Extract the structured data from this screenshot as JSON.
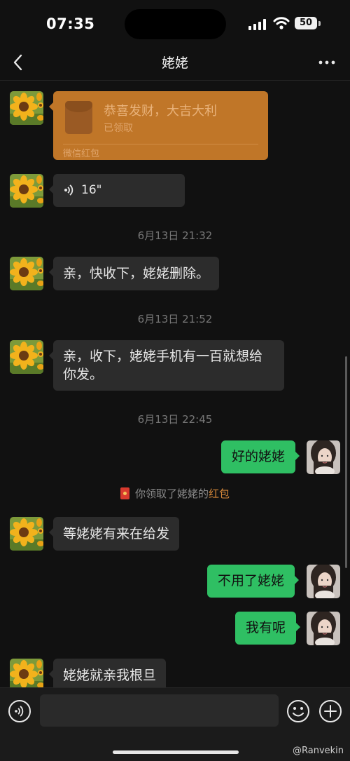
{
  "status_bar": {
    "time": "07:35",
    "battery": "50"
  },
  "header": {
    "title": "姥姥"
  },
  "messages": {
    "red_packet": {
      "title": "恭喜发财，大吉大利",
      "status": "已领取",
      "footer": "微信红包"
    },
    "voice": {
      "duration": "16\""
    },
    "ts1": "6月13日 21:32",
    "m1": "亲，快收下，姥姥删除。",
    "ts2": "6月13日 21:52",
    "m2_line1": "亲，收下，姥姥手机有一百就想给",
    "m2_line2": "你发。",
    "ts3": "6月13日 22:45",
    "m3": "好的姥姥",
    "system_prefix": "你领取了姥姥的",
    "system_link": "红包",
    "m4": "等姥姥有来在给发",
    "m5": "不用了姥姥",
    "m6": "我有呢",
    "m7": "姥姥就亲我根旦"
  },
  "watermark": "@Ranvekin",
  "colors": {
    "outgoing_bubble": "#2fbf63",
    "incoming_bubble": "#2c2c2c",
    "red_packet": "#c07628",
    "background": "#111111"
  },
  "icons": [
    "back-icon",
    "more-icon",
    "voice-message-icon",
    "voice-input-icon",
    "emoji-icon",
    "plus-icon",
    "red-packet-icon"
  ]
}
